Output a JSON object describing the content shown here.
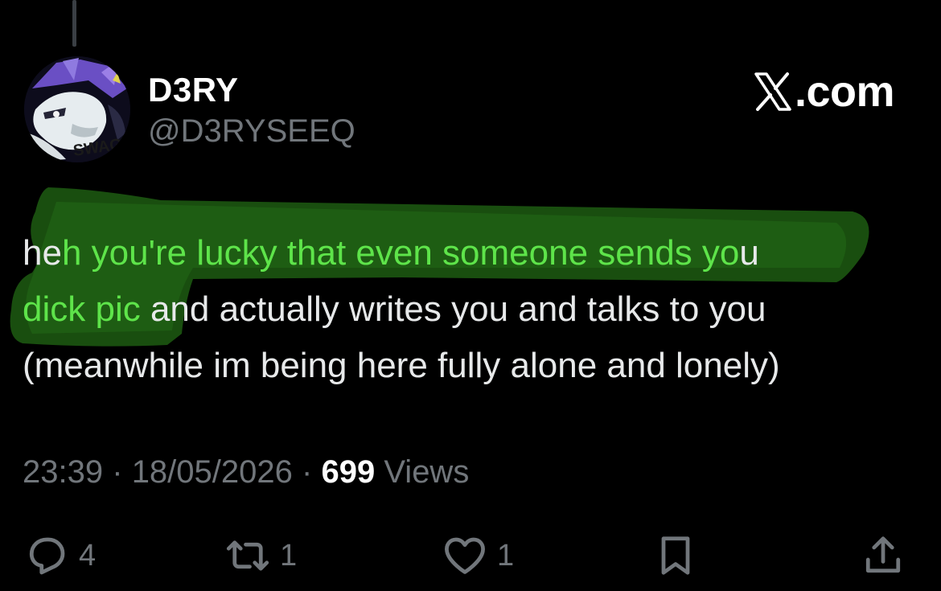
{
  "author": {
    "display_name": "D3RY",
    "handle": "@D3RYSEEQ",
    "avatar_icon": "avatar-image"
  },
  "brand": {
    "icon": "x-logo-icon",
    "text": ".com"
  },
  "tweet": {
    "text_segments": [
      {
        "text": "he",
        "highlighted": false
      },
      {
        "text": "h you're lucky that even someone sends yo",
        "highlighted": true
      },
      {
        "text": "u\n",
        "highlighted": false
      },
      {
        "text": "dick pic ",
        "highlighted": true
      },
      {
        "text": "and actually writes you and talks to you\n(meanwhile im being here fully alone and lonely)",
        "highlighted": false
      }
    ],
    "highlight_color": "#5ee44a",
    "swash_color": "#1f6a10"
  },
  "meta": {
    "time": "23:39",
    "date": "18/05/2026",
    "views_count": "699",
    "views_label": "Views",
    "separator": "·"
  },
  "actions": {
    "reply": {
      "icon": "reply-icon",
      "count": "4"
    },
    "repost": {
      "icon": "repost-icon",
      "count": "1"
    },
    "like": {
      "icon": "heart-icon",
      "count": "1"
    },
    "bookmark": {
      "icon": "bookmark-icon"
    },
    "share": {
      "icon": "share-icon"
    }
  },
  "colors": {
    "background": "#000000",
    "text": "#e7e9ea",
    "muted": "#71767b"
  }
}
